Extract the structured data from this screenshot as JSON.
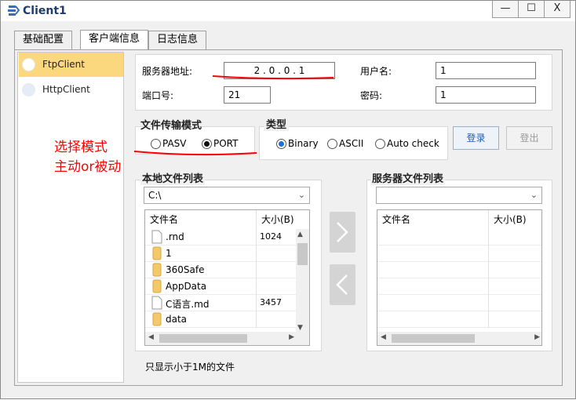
{
  "window": {
    "title": "Client1",
    "controls": {
      "minimize": "—",
      "maximize": "☐",
      "close": "X"
    }
  },
  "tabs": [
    {
      "label": "基础配置"
    },
    {
      "label": "客户端信息"
    },
    {
      "label": "日志信息"
    }
  ],
  "sidebar": {
    "items": [
      {
        "label": "FtpClient"
      },
      {
        "label": "HttpClient"
      }
    ]
  },
  "server": {
    "address_label": "服务器地址:",
    "address_value": "2  .  0  .  0  .  1",
    "username_label": "用户名:",
    "username_value": "1",
    "port_label": "端口号:",
    "port_value": "21",
    "password_label": "密码:",
    "password_value": "1"
  },
  "transfer_mode": {
    "title": "文件传输模式",
    "options": [
      "PASV",
      "PORT"
    ],
    "selected": "PORT"
  },
  "type": {
    "title": "类型",
    "options": [
      "Binary",
      "ASCII",
      "Auto check"
    ],
    "selected": "Binary"
  },
  "buttons": {
    "login": "登录",
    "logout": "登出"
  },
  "annotation": {
    "line1": "选择模式",
    "line2": "主动or被动",
    "color": "#ff0000"
  },
  "local_list": {
    "title": "本地文件列表",
    "path": "C:\\",
    "col_name": "文件名",
    "col_size": "大小(B)",
    "rows": [
      {
        "name": ".rnd",
        "size": "1024",
        "icon": "file-icon"
      },
      {
        "name": "1",
        "size": "",
        "icon": "folder-icon"
      },
      {
        "name": "360Safe",
        "size": "",
        "icon": "folder-icon"
      },
      {
        "name": "AppData",
        "size": "",
        "icon": "folder-icon"
      },
      {
        "name": "C语言.md",
        "size": "3457",
        "icon": "file-icon"
      },
      {
        "name": "data",
        "size": "",
        "icon": "folder-icon"
      }
    ]
  },
  "server_list": {
    "title": "服务器文件列表",
    "path": "",
    "col_name": "文件名",
    "col_size": "大小(B)"
  },
  "footer": {
    "note": "只显示小于1M的文件"
  }
}
